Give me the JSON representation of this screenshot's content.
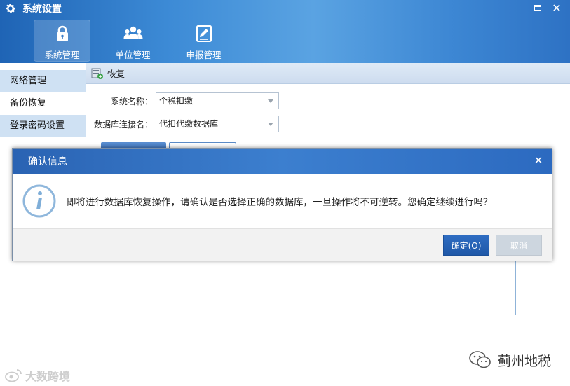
{
  "window": {
    "title": "系统设置"
  },
  "nav": {
    "tabs": [
      {
        "label": "系统管理",
        "icon": "lock-icon"
      },
      {
        "label": "单位管理",
        "icon": "users-icon"
      },
      {
        "label": "申报管理",
        "icon": "edit-form-icon"
      }
    ]
  },
  "sidebar": {
    "items": [
      {
        "label": "网络管理"
      },
      {
        "label": "备份恢复"
      },
      {
        "label": "登录密码设置"
      }
    ]
  },
  "panel": {
    "title": "恢复",
    "fields": [
      {
        "label": "系统名称：",
        "value": "个税扣缴"
      },
      {
        "label": "数据库连接名：",
        "value": "代扣代缴数据库"
      }
    ]
  },
  "dialog": {
    "title": "确认信息",
    "message": "即将进行数据库恢复操作，请确认是否选择正确的数据库，一旦操作将不可逆转。您确定继续进行吗？",
    "ok_label": "确定(O)",
    "cancel_label": "取消"
  },
  "watermarks": {
    "right": "蓟州地税",
    "left": "大数跨境"
  },
  "colors": {
    "header_blue": "#2e72c4",
    "dialog_title_blue": "#3c7fcf",
    "primary_button": "#1f58a8",
    "sidebar_bg": "#cfe1f3"
  }
}
